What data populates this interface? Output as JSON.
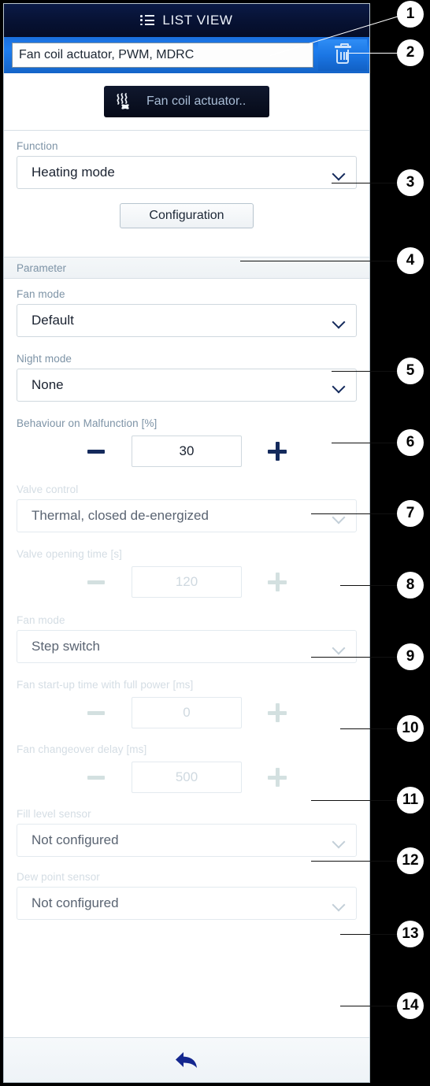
{
  "window": {
    "title": "LIST VIEW",
    "title_icon": "list-icon"
  },
  "name_row": {
    "device_name": "Fan coil actuator, PWM, MDRC",
    "placeholder": "Device name",
    "delete_icon": "trash-icon"
  },
  "device_chip": {
    "label": "Fan coil actuator..",
    "icon": "heat-fan-icon"
  },
  "function_section": {
    "label": "Function",
    "value": "Heating mode",
    "chevron": "chevron-down-icon"
  },
  "configuration": {
    "button_label": "Configuration"
  },
  "parameter_section": {
    "header": "Parameter",
    "fields": [
      {
        "id": "fan-mode",
        "type": "select",
        "label": "Fan mode",
        "value": "Default",
        "disabled": false
      },
      {
        "id": "night-mode",
        "type": "select",
        "label": "Night mode",
        "value": "None",
        "disabled": false
      },
      {
        "id": "behaviour-on-malfunction",
        "type": "stepper",
        "label": "Behaviour on Malfunction [%]",
        "value": "30",
        "disabled": false,
        "minus_label": "−",
        "plus_label": "+"
      },
      {
        "id": "valve-control",
        "type": "select",
        "label": "Valve control",
        "value": "Thermal, closed de-energized",
        "disabled": true
      },
      {
        "id": "valve-opening-time",
        "type": "stepper",
        "label": "Valve opening time [s]",
        "value": "120",
        "disabled": true,
        "minus_label": "−",
        "plus_label": "+"
      },
      {
        "id": "fan-mode-2",
        "type": "select",
        "label": "Fan mode",
        "value": "Step switch",
        "disabled": true
      },
      {
        "id": "fan-startup-time",
        "type": "stepper",
        "label": "Fan start-up time with full power [ms]",
        "value": "0",
        "disabled": true,
        "minus_label": "−",
        "plus_label": "+"
      },
      {
        "id": "fan-changeover-delay",
        "type": "stepper",
        "label": "Fan changeover delay [ms]",
        "value": "500",
        "disabled": true,
        "minus_label": "−",
        "plus_label": "+"
      },
      {
        "id": "fill-level-sensor",
        "type": "select",
        "label": "Fill level sensor",
        "value": "Not configured",
        "disabled": true
      },
      {
        "id": "dew-point-sensor",
        "type": "select",
        "label": "Dew point sensor",
        "value": "Not configured",
        "disabled": true
      }
    ]
  },
  "footer": {
    "back_icon": "back-arrow-icon"
  },
  "callouts": [
    {
      "number": "1"
    },
    {
      "number": "2"
    },
    {
      "number": "3"
    },
    {
      "number": "4"
    },
    {
      "number": "5"
    },
    {
      "number": "6"
    },
    {
      "number": "7"
    },
    {
      "number": "8"
    },
    {
      "number": "9"
    },
    {
      "number": "10"
    },
    {
      "number": "11"
    },
    {
      "number": "12"
    },
    {
      "number": "13"
    },
    {
      "number": "14"
    }
  ],
  "colors": {
    "titlebar_dark": "#071234",
    "namerow_blue": "#1e7ef0",
    "accent_navy": "#142a5c",
    "label_gray": "#7d93a6",
    "disabled_gray": "#d4dde4",
    "panel_bg": "#ffffff",
    "backdrop": "#000000"
  }
}
